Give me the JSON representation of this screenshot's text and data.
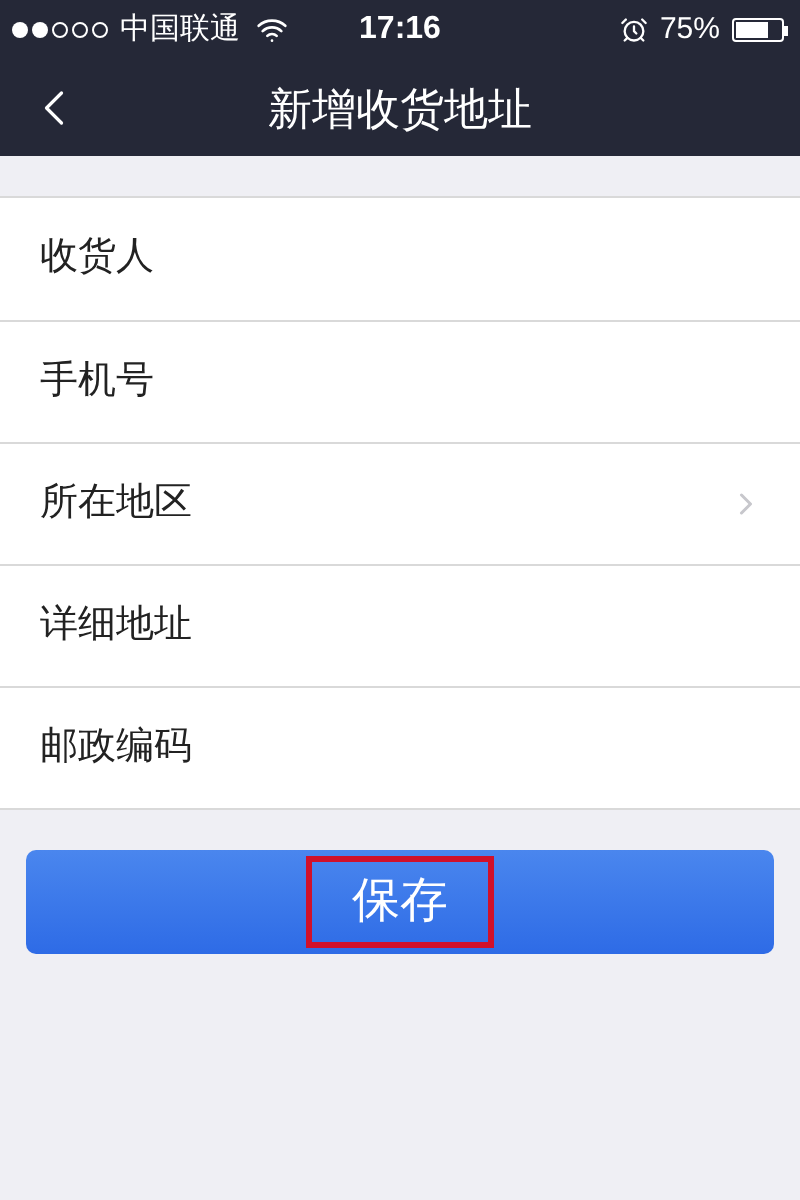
{
  "status_bar": {
    "carrier": "中国联通",
    "time": "17:16",
    "battery": "75%"
  },
  "nav": {
    "title": "新增收货地址"
  },
  "form_rows": [
    {
      "label": "收货人",
      "kind": "field"
    },
    {
      "label": "手机号",
      "kind": "field"
    },
    {
      "label": "所在地区",
      "kind": "picker"
    },
    {
      "label": "详细地址",
      "kind": "field"
    },
    {
      "label": "邮政编码",
      "kind": "field"
    }
  ],
  "save_button": {
    "label": "保存",
    "highlighted": true
  }
}
